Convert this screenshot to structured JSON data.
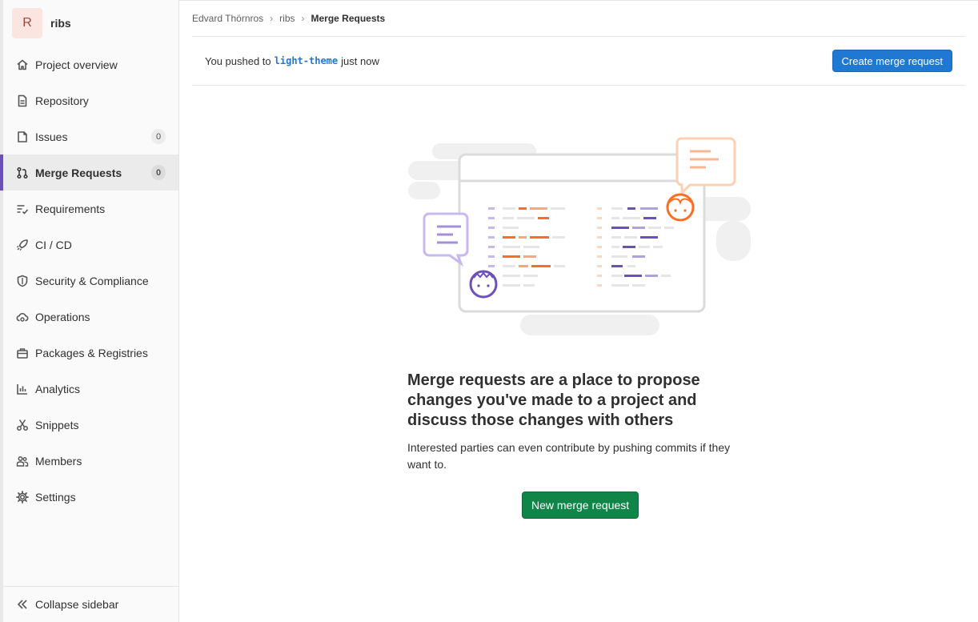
{
  "project": {
    "avatar_letter": "R",
    "name": "ribs"
  },
  "sidebar": {
    "items": [
      {
        "label": "Project overview",
        "icon": "home-icon"
      },
      {
        "label": "Repository",
        "icon": "doc-icon"
      },
      {
        "label": "Issues",
        "icon": "issues-icon",
        "count": "0"
      },
      {
        "label": "Merge Requests",
        "icon": "merge-request-icon",
        "count": "0",
        "active": true
      },
      {
        "label": "Requirements",
        "icon": "requirements-icon"
      },
      {
        "label": "CI / CD",
        "icon": "rocket-icon"
      },
      {
        "label": "Security & Compliance",
        "icon": "shield-icon"
      },
      {
        "label": "Operations",
        "icon": "cloud-gear-icon"
      },
      {
        "label": "Packages & Registries",
        "icon": "package-icon"
      },
      {
        "label": "Analytics",
        "icon": "chart-icon"
      },
      {
        "label": "Snippets",
        "icon": "scissors-icon"
      },
      {
        "label": "Members",
        "icon": "users-icon"
      },
      {
        "label": "Settings",
        "icon": "gear-icon"
      }
    ],
    "collapse_label": "Collapse sidebar"
  },
  "breadcrumb": {
    "owner": "Edvard Thörnros",
    "project": "ribs",
    "current": "Merge Requests"
  },
  "push_notice": {
    "prefix": "You pushed to",
    "branch": "light-theme",
    "suffix": "just now",
    "button": "Create merge request"
  },
  "empty_state": {
    "title": "Merge requests are a place to propose changes you've made to a project and discuss those changes with others",
    "description": "Interested parties can even contribute by pushing commits if they want to.",
    "button": "New merge request"
  },
  "colors": {
    "accent_blue": "#1f78d1",
    "accent_green": "#108548",
    "active_bar": "#6b4fbb",
    "orange": "#fc6d26",
    "purple": "#6b4fbb"
  }
}
